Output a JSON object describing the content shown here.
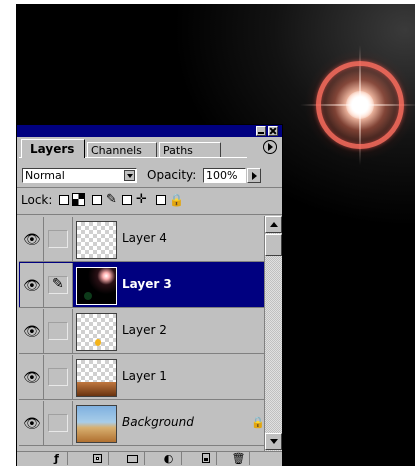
{
  "panel": {
    "tabs": [
      {
        "label": "Layers",
        "active": true
      },
      {
        "label": "Channels",
        "active": false
      },
      {
        "label": "Paths",
        "active": false
      }
    ],
    "blend_mode": "Normal",
    "opacity_label": "Opacity:",
    "opacity_value": "100%",
    "lock_label": "Lock:",
    "layers": [
      {
        "name": "Layer 4",
        "visible": true,
        "selected": false
      },
      {
        "name": "Layer 3",
        "visible": true,
        "selected": true
      },
      {
        "name": "Layer 2",
        "visible": true,
        "selected": false
      },
      {
        "name": "Layer 1",
        "visible": true,
        "selected": false
      },
      {
        "name": "Background",
        "visible": true,
        "selected": false
      }
    ]
  },
  "icons": {
    "eye": "eye-icon",
    "brush": "brush-icon",
    "move": "move-icon",
    "lock": "lock-icon",
    "layer_style": "layer-style-icon",
    "mask": "mask-icon",
    "new_set": "folder-icon",
    "adjustment": "adjustment-icon",
    "new_layer": "new-layer-icon",
    "trash": "trash-icon"
  },
  "colors": {
    "title_bar": "#000080",
    "selection": "#000080",
    "panel_bg": "#c0c0c0",
    "flare_ring": "#ff6e5f"
  }
}
